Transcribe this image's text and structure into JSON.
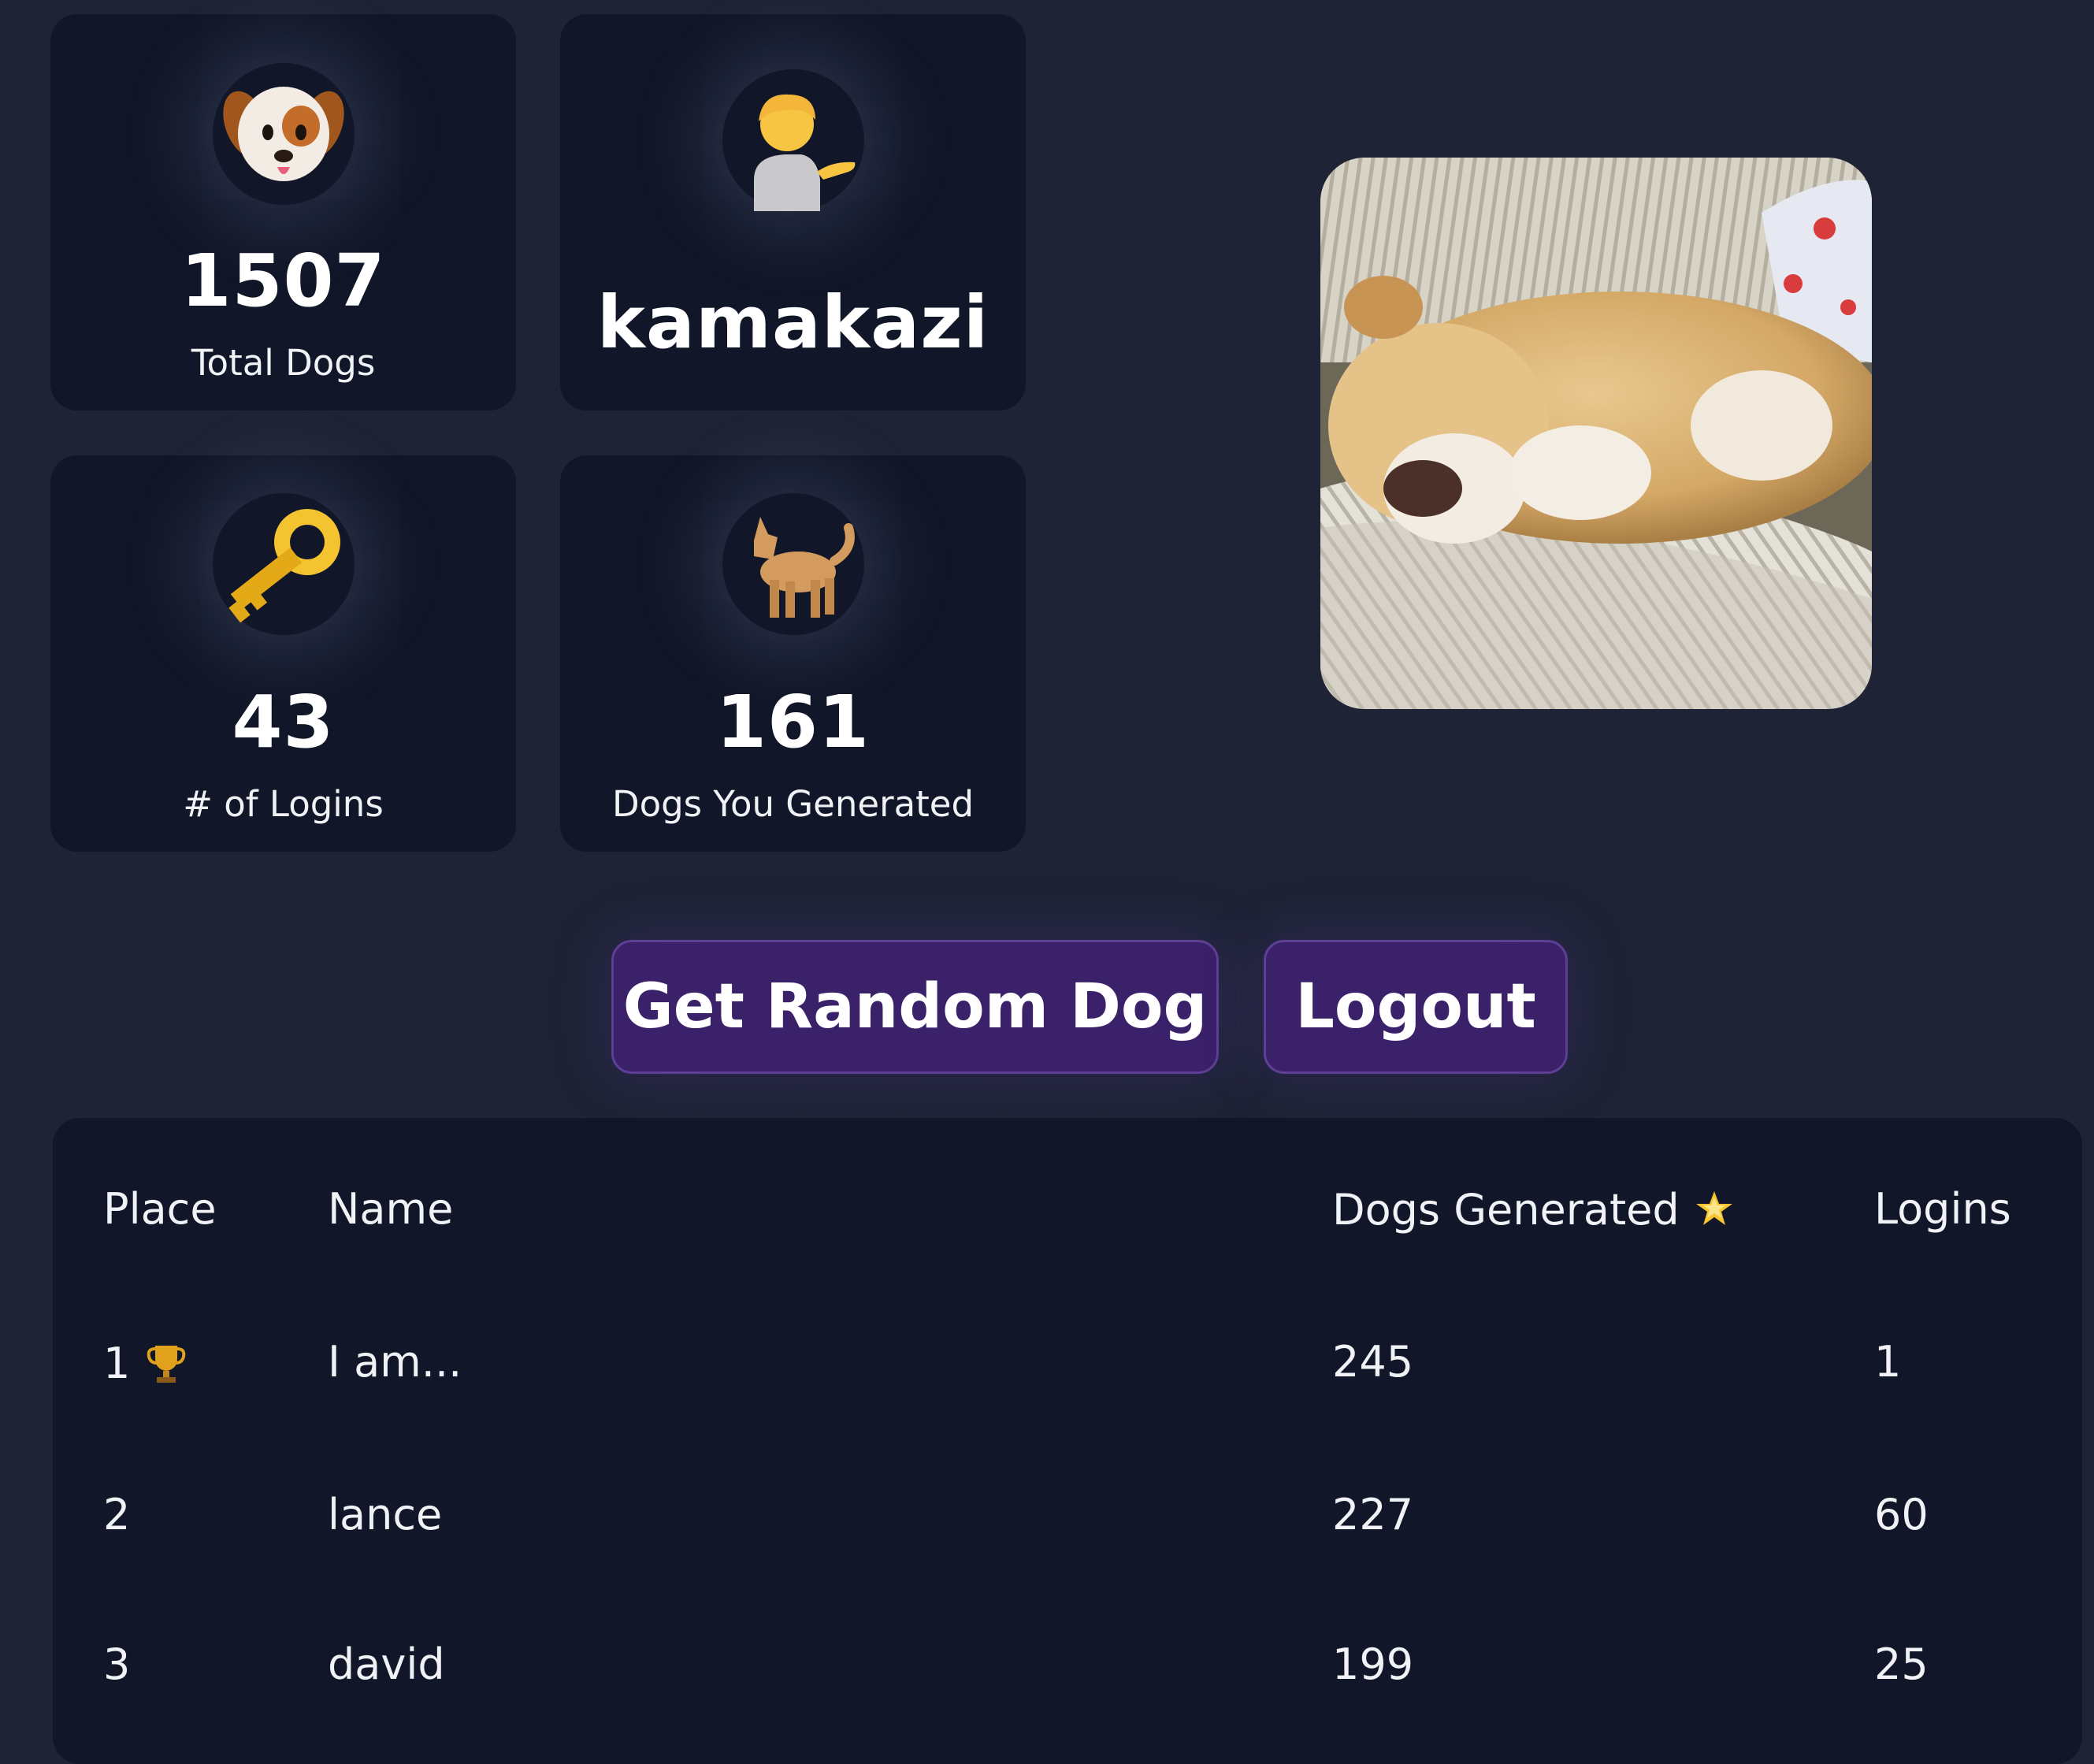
{
  "stats": {
    "total_dogs": {
      "value": "1507",
      "label": "Total Dogs",
      "icon": "dog-face-icon"
    },
    "user": {
      "value": "kamakazi",
      "icon": "person-tipping-hand-icon"
    },
    "logins": {
      "value": "43",
      "label": "# of Logins",
      "icon": "key-icon"
    },
    "generated": {
      "value": "161",
      "label": "Dogs You Generated",
      "icon": "dog-icon"
    }
  },
  "dog_photo": {
    "icon": "dog-photo-image"
  },
  "actions": {
    "random_label": "Get Random Dog",
    "logout_label": "Logout"
  },
  "leaderboard": {
    "headers": {
      "place": "Place",
      "name": "Name",
      "dogs": "Dogs Generated",
      "dogs_icon": "glowing-star-icon",
      "logins": "Logins"
    },
    "rows": [
      {
        "place": "1",
        "badge": "trophy-icon",
        "name": "I am...",
        "dogs": "245",
        "logins": "1"
      },
      {
        "place": "2",
        "name": "lance",
        "dogs": "227",
        "logins": "60"
      },
      {
        "place": "3",
        "name": "david",
        "dogs": "199",
        "logins": "25"
      }
    ]
  },
  "colors": {
    "background": "#1e2335",
    "card": "#111628",
    "button": "#3b2169",
    "button_border": "#5e3f96"
  }
}
